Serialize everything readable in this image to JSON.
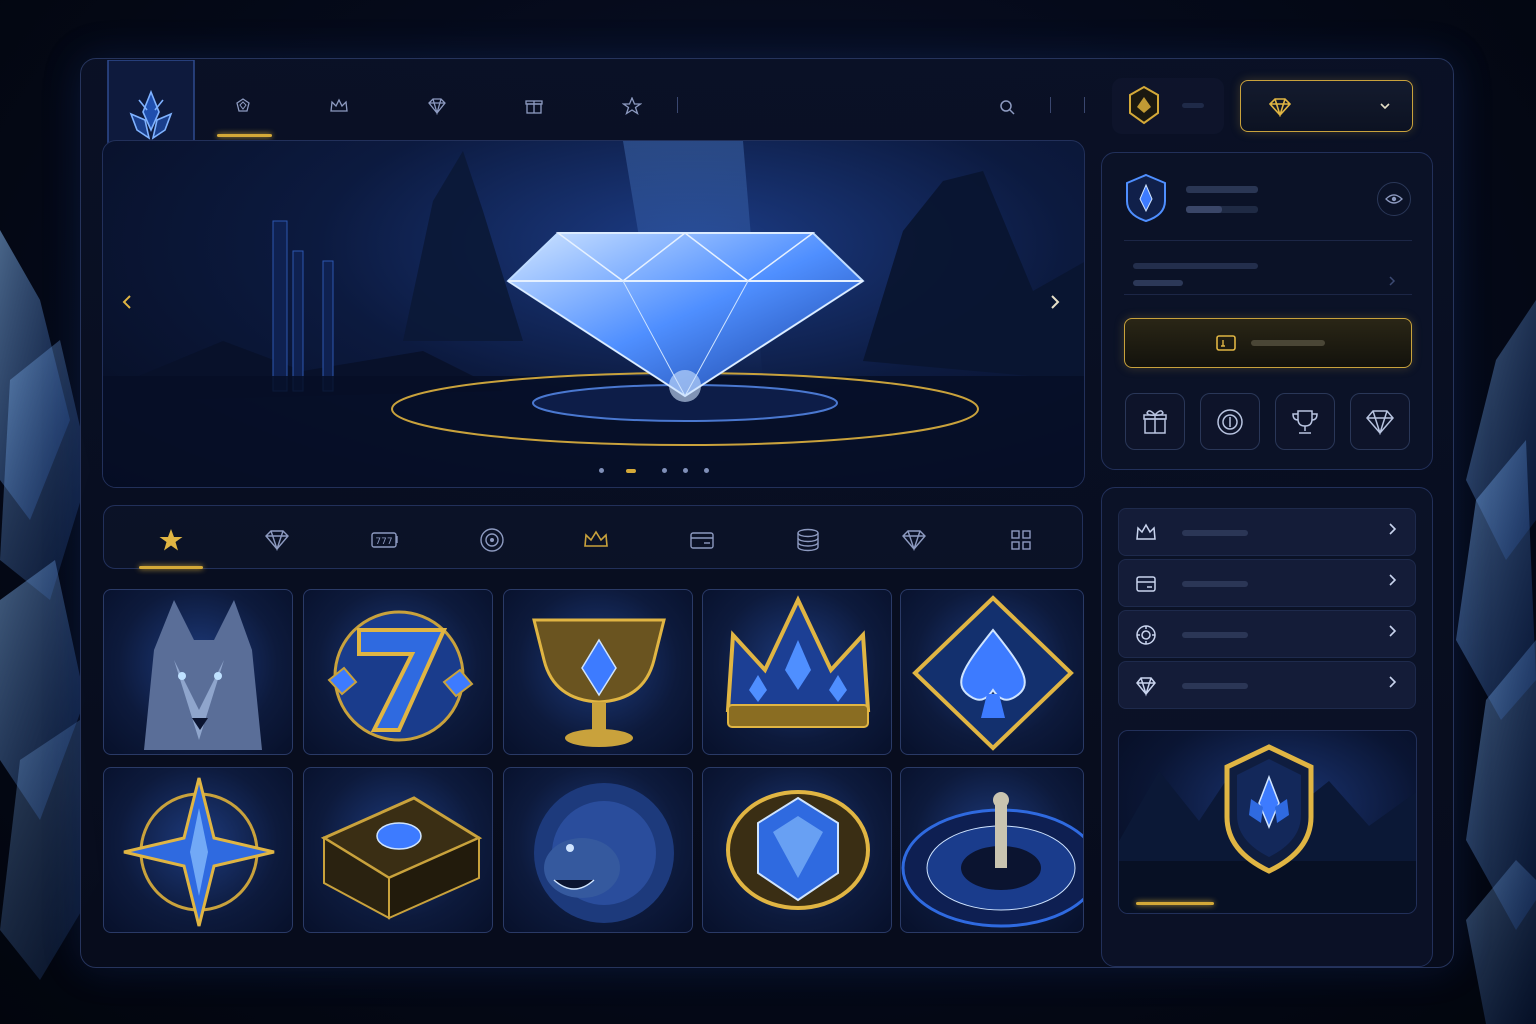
{
  "nav": {
    "items": [
      {
        "name": "casino",
        "icon": "gem-badge-icon"
      },
      {
        "name": "vip",
        "icon": "crown-icon"
      },
      {
        "name": "jackpots",
        "icon": "diamond-icon"
      },
      {
        "name": "promotions",
        "icon": "gift-icon"
      },
      {
        "name": "favorites",
        "icon": "star-icon"
      }
    ],
    "active_index": 0
  },
  "header": {
    "search_icon": "search-icon",
    "avatar_icon": "avatar-badge-icon",
    "currency_icon": "diamond-icon",
    "dropdown_icon": "chevron-down-icon"
  },
  "hero": {
    "slide_count": 5,
    "active_slide": 1
  },
  "categories": [
    {
      "name": "featured",
      "icon": "star-icon"
    },
    {
      "name": "diamond",
      "icon": "diamond-icon"
    },
    {
      "name": "slots",
      "icon": "slot-777-icon"
    },
    {
      "name": "roulette",
      "icon": "target-icon"
    },
    {
      "name": "vip",
      "icon": "crown-icon"
    },
    {
      "name": "wallet",
      "icon": "card-icon"
    },
    {
      "name": "table",
      "icon": "chips-stack-icon"
    },
    {
      "name": "jackpot",
      "icon": "diamond-icon"
    },
    {
      "name": "all",
      "icon": "grid-icon"
    }
  ],
  "active_category": 0,
  "games": [
    {
      "name": "wolf"
    },
    {
      "name": "lucky-seven"
    },
    {
      "name": "golden-chalice"
    },
    {
      "name": "crystal-crown"
    },
    {
      "name": "ace-of-spades"
    },
    {
      "name": "compass-star"
    },
    {
      "name": "treasure-chest"
    },
    {
      "name": "lion"
    },
    {
      "name": "sapphire-amulet"
    },
    {
      "name": "roulette"
    }
  ],
  "wallet": {
    "quick_actions": [
      {
        "name": "gifts",
        "icon": "gift-icon"
      },
      {
        "name": "coins",
        "icon": "coin-icon"
      },
      {
        "name": "trophy",
        "icon": "trophy-icon"
      },
      {
        "name": "gems",
        "icon": "diamond-icon"
      }
    ]
  },
  "menu": [
    {
      "name": "vip-club",
      "icon": "crown-icon"
    },
    {
      "name": "cashier",
      "icon": "wallet-icon"
    },
    {
      "name": "chips",
      "icon": "chip-icon"
    },
    {
      "name": "rewards",
      "icon": "diamond-icon"
    }
  ],
  "colors": {
    "accent_gold": "#d4a938",
    "accent_blue": "#3d7bff",
    "panel": "#0c1328"
  }
}
